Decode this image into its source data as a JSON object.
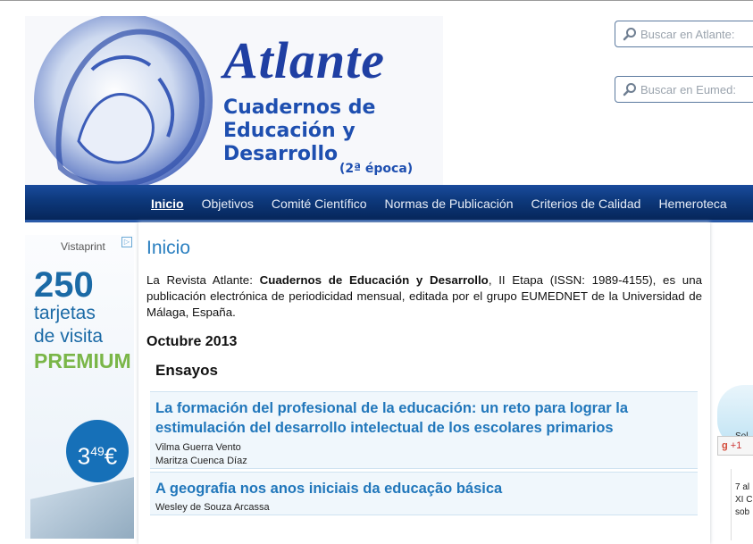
{
  "header": {
    "logo_title": "Atlante",
    "logo_sub1": "Cuadernos de",
    "logo_sub2": "Educación y",
    "logo_sub3": "Desarrollo",
    "logo_epoca": "(2ª época)"
  },
  "search": {
    "atlante_placeholder": "Buscar en Atlante:",
    "eumed_placeholder": "Buscar en Eumed:"
  },
  "nav": {
    "items": [
      "Inicio",
      "Objetivos",
      "Comité Científico",
      "Normas de Publicación",
      "Criterios de Calidad",
      "Hemeroteca"
    ]
  },
  "ad_left": {
    "brand": "Vistaprint",
    "number": "250",
    "line1": "tarjetas",
    "line2": "de visita",
    "premium": "PREMIUM",
    "price_main": "3",
    "price_sup": "49",
    "price_currency": "€"
  },
  "main": {
    "page_title": "Inicio",
    "intro_prefix": "La Revista Atlante: ",
    "intro_bold": "Cuadernos de Educación y Desarrollo",
    "intro_rest": ", II Etapa (ISSN: 1989-4155), es una publicación electrónica de periodicidad mensual, editada por el grupo EUMEDNET de la Universidad de Málaga, España.",
    "issue": "Octubre 2013",
    "section": "Ensayos",
    "articles": [
      {
        "title": "La formación del profesional de la educación: un reto para lograr la estimulación del desarrollo intelectual de los escolares primarios",
        "authors": [
          "Vilma Guerra Vento",
          "Maritza Cuenca Díaz"
        ]
      },
      {
        "title": "A geografia nos anos iniciais da educação básica",
        "authors": [
          "Wesley de Souza Arcassa"
        ]
      }
    ]
  },
  "right": {
    "blob_text": "Sol",
    "gplus": "+1",
    "text_lines": [
      "7 al",
      "XI C",
      "sob"
    ]
  }
}
